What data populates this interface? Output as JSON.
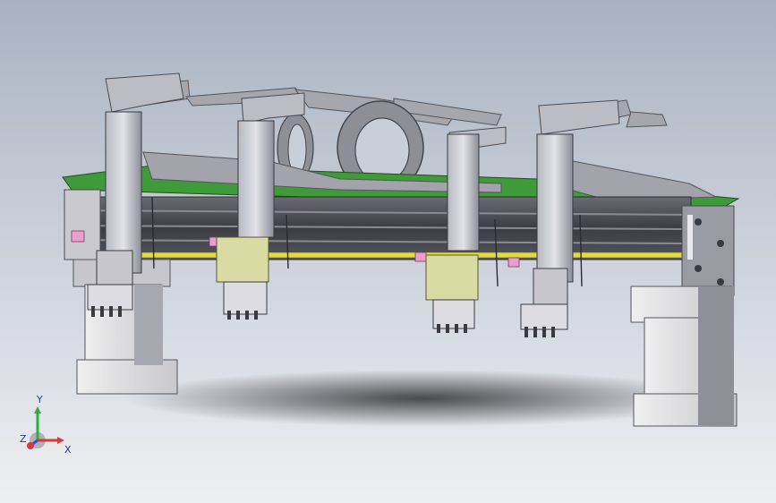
{
  "viewport": {
    "background_top": "#a9b2c2",
    "background_bottom": "#eeeff2"
  },
  "colors": {
    "steel_light": "#c9c9cf",
    "steel_mid": "#9a9aa3",
    "steel_dark": "#5e5e66",
    "pcb_green": "#3f9a3a",
    "pillar": "#d4d4d8",
    "pillar_face": "#ebebee",
    "block_yellow": "#d8dba2",
    "accent_pink": "#e99fcc",
    "accent_yellow": "#e2d84a",
    "shadow": "#3a3a3e"
  },
  "triad": {
    "x_label": "X",
    "y_label": "Y",
    "z_label": "Z",
    "x_color": "#d43a3a",
    "y_color": "#2bb03a",
    "z_color": "#3a4ad4"
  }
}
